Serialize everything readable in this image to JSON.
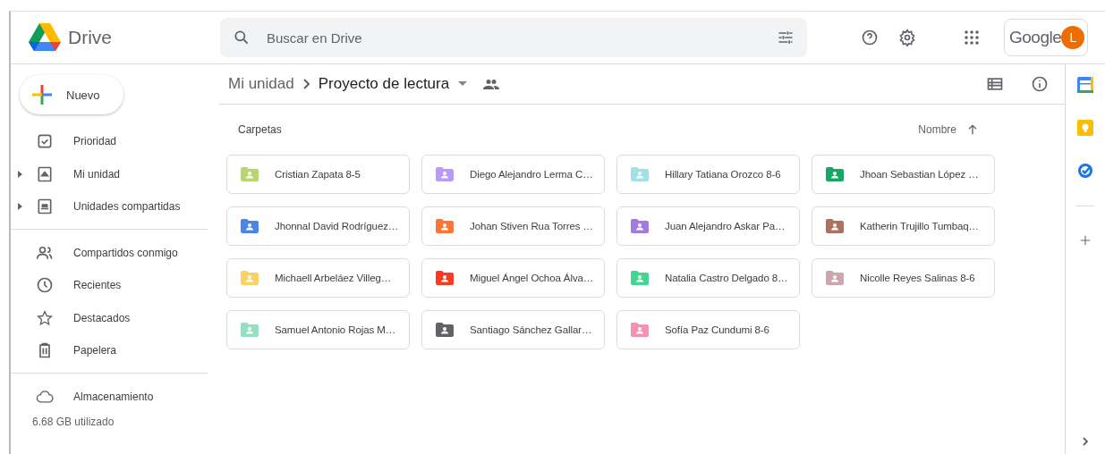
{
  "app": {
    "title": "Drive"
  },
  "search": {
    "placeholder": "Buscar en Drive"
  },
  "account": {
    "brand": "Google",
    "avatar": "L"
  },
  "new_button": {
    "label": "Nuevo"
  },
  "sidebar": {
    "groups": [
      [
        {
          "label": "Prioridad"
        },
        {
          "label": "Mi unidad",
          "expanded": false
        },
        {
          "label": "Unidades compartidas",
          "expanded": false
        }
      ],
      [
        {
          "label": "Compartidos conmigo"
        },
        {
          "label": "Recientes"
        },
        {
          "label": "Destacados"
        },
        {
          "label": "Papelera"
        }
      ],
      [
        {
          "label": "Almacenamiento"
        }
      ]
    ],
    "storage": "6.68 GB utilizado"
  },
  "breadcrumb": {
    "root": "Mi unidad",
    "current": "Proyecto de lectura"
  },
  "section": {
    "title": "Carpetas",
    "sort": "Nombre"
  },
  "folders": [
    {
      "name": "Cristian Zapata 8-5",
      "color": "#b4d86c"
    },
    {
      "name": "Diego Alejandro Lerma C…",
      "color": "#b99afc"
    },
    {
      "name": "Hillary Tatiana Orozco 8-6",
      "color": "#9fe1e7"
    },
    {
      "name": "Jhoan Sebastian López …",
      "color": "#16a766"
    },
    {
      "name": "Jhonnal David Rodríguez…",
      "color": "#4986e7"
    },
    {
      "name": "Johan Stiven Rua Torres …",
      "color": "#ff7537"
    },
    {
      "name": "Juan Alejandro Askar Pa…",
      "color": "#a47ae2"
    },
    {
      "name": "Katherin Trujillo Tumbaq…",
      "color": "#ac725e"
    },
    {
      "name": "Michaell Arbeláez Villeg…",
      "color": "#fad165"
    },
    {
      "name": "Miguel Ángel Ochoa Álva…",
      "color": "#f83a22"
    },
    {
      "name": "Natalia Castro Delgado 8…",
      "color": "#42d692"
    },
    {
      "name": "Nicolle Reyes Salinas 8-6",
      "color": "#cca6ac"
    },
    {
      "name": "Samuel Antonio Rojas M…",
      "color": "#92e1c0"
    },
    {
      "name": "Santiago Sánchez Gallar…",
      "color": "#5f6368"
    },
    {
      "name": "Sofía Paz Cundumi 8-6",
      "color": "#f691b2"
    }
  ]
}
